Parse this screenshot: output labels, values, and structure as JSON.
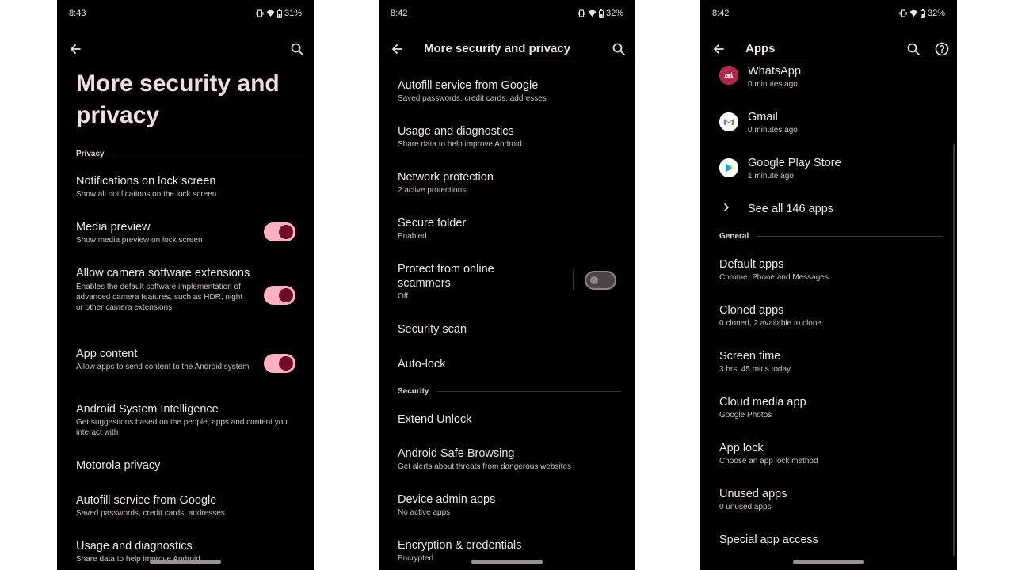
{
  "screen1": {
    "status": {
      "time": "8:43",
      "battery": "31%"
    },
    "title": "More security and privacy",
    "section_privacy": "Privacy",
    "items": [
      {
        "title": "Notifications on lock screen",
        "subtitle": "Show all notifications on the lock screen"
      },
      {
        "title": "Media preview",
        "subtitle": "Show media preview on lock screen",
        "toggle": "on"
      },
      {
        "title": "Allow camera software extensions",
        "subtitle": "Enables the default software implementation of advanced camera features, such as HDR, night or other camera extensions",
        "toggle": "on"
      },
      {
        "title": "App content",
        "subtitle": "Allow apps to send content to the Android system",
        "toggle": "on"
      },
      {
        "title": "Android System Intelligence",
        "subtitle": "Get suggestions based on the people, apps and content you interact with"
      },
      {
        "title": "Motorola privacy"
      },
      {
        "title": "Autofill service from Google",
        "subtitle": "Saved passwords, credit cards, addresses"
      },
      {
        "title": "Usage and diagnostics",
        "subtitle": "Share data to help improve Android"
      }
    ]
  },
  "screen2": {
    "status": {
      "time": "8:42",
      "battery": "32%"
    },
    "title": "More security and privacy",
    "items": [
      {
        "title": "Autofill service from Google",
        "subtitle": "Saved passwords, credit cards, addresses"
      },
      {
        "title": "Usage and diagnostics",
        "subtitle": "Share data to help improve Android"
      },
      {
        "title": "Network protection",
        "subtitle": "2 active protections"
      },
      {
        "title": "Secure folder",
        "subtitle": "Enabled"
      },
      {
        "title": "Protect from online scammers",
        "subtitle": "Off",
        "toggle": "off"
      },
      {
        "title": "Security scan"
      },
      {
        "title": "Auto-lock"
      }
    ],
    "section_security": "Security",
    "security_items": [
      {
        "title": "Extend Unlock"
      },
      {
        "title": "Android Safe Browsing",
        "subtitle": "Get alerts about threats from dangerous websites"
      },
      {
        "title": "Device admin apps",
        "subtitle": "No active apps"
      },
      {
        "title": "Encryption & credentials",
        "subtitle": "Encrypted"
      }
    ]
  },
  "screen3": {
    "status": {
      "time": "8:42",
      "battery": "32%"
    },
    "title": "Apps",
    "recent_apps": [
      {
        "name": "WhatsApp",
        "time": "0 minutes ago",
        "icon": "android-icon"
      },
      {
        "name": "Gmail",
        "time": "0 minutes ago",
        "icon": "gmail-icon"
      },
      {
        "name": "Google Play Store",
        "time": "1 minute ago",
        "icon": "play-store-icon"
      }
    ],
    "see_all": "See all 146 apps",
    "section_general": "General",
    "items": [
      {
        "title": "Default apps",
        "subtitle": "Chrome, Phone and Messages"
      },
      {
        "title": "Cloned apps",
        "subtitle": "0 cloned, 2 available to clone"
      },
      {
        "title": "Screen time",
        "subtitle": "3 hrs, 45 mins today"
      },
      {
        "title": "Cloud media app",
        "subtitle": "Google Photos"
      },
      {
        "title": "App lock",
        "subtitle": "Choose an app lock method"
      },
      {
        "title": "Unused apps",
        "subtitle": "0 unused apps"
      },
      {
        "title": "Special app access"
      }
    ]
  },
  "colors": {
    "background": "#000000",
    "toggle_on_track": "#ffb1c0",
    "toggle_on_knob": "#6f0b26",
    "title_pink": "#f1dde2"
  }
}
